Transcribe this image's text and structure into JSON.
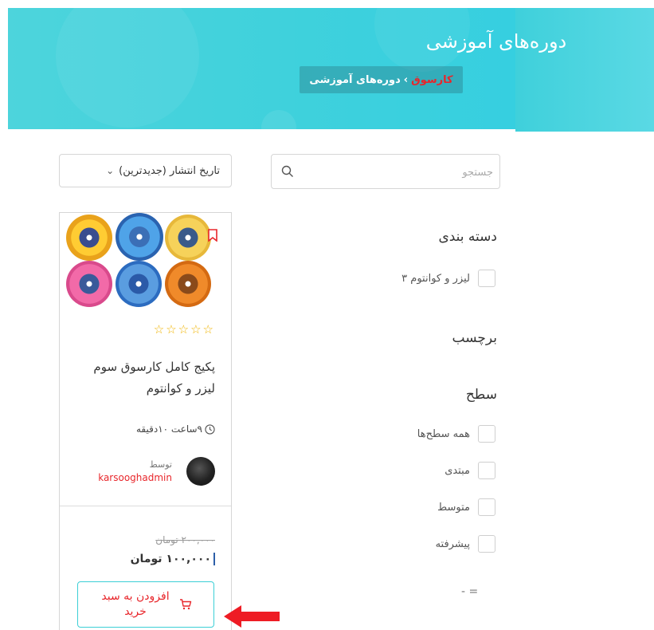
{
  "hero": {
    "title": "دوره‌های آموزشی",
    "breadcrumb_home": "کارسوق",
    "breadcrumb_sep": "›",
    "breadcrumb_current": "دوره‌های آموزشی"
  },
  "search": {
    "placeholder": "جستجو",
    "value": ""
  },
  "sort": {
    "selected": "تاریخ انتشار (جدیدترین)"
  },
  "filters": {
    "category": {
      "title": "دسته بندی",
      "options": [
        "لیزر و کوانتوم ۳"
      ]
    },
    "tag": {
      "title": "برچسب"
    },
    "level": {
      "title": "سطح",
      "options": [
        "همه سطح‌ها",
        "مبتدی",
        "متوسط",
        "پیشرفته"
      ]
    },
    "collapsed_label": "- ="
  },
  "course": {
    "rating_stars": "☆☆☆☆☆",
    "rating_value": 0,
    "title": "پکیج کامل کارسوق سوم لیزر و کوانتوم",
    "duration": "۹ساعت ۱۰دقیقه",
    "author_prefix": "توسط",
    "author_name": "karsooghadmin",
    "old_price": "۲۰۰,۰۰۰ تومان",
    "price": "۱۰۰,۰۰۰ تومان",
    "add_to_cart": "افزودن به سبد خرید"
  },
  "colors": {
    "hero": "#3fd1dc",
    "accent_red": "#e8262b",
    "cart_border": "#3ccfd6",
    "star": "#f0b400"
  }
}
